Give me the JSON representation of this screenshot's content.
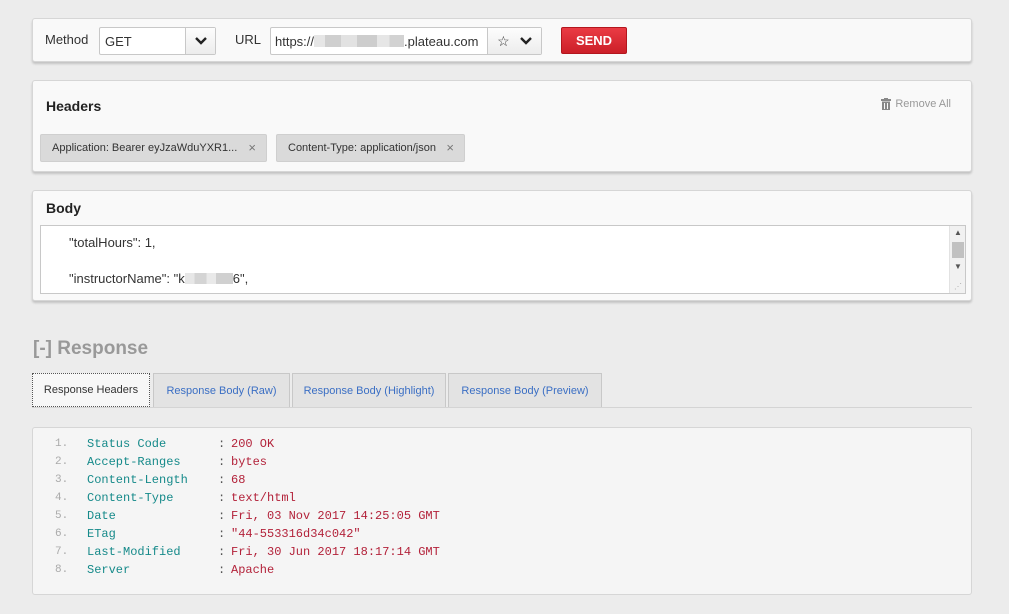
{
  "request": {
    "method_label": "Method",
    "method_value": "GET",
    "url_label": "URL",
    "url_prefix": "https://",
    "url_suffix": ".plateau.com",
    "send_label": "SEND"
  },
  "headers": {
    "title": "Headers",
    "remove_all_label": "Remove All",
    "items": [
      {
        "label": "Application: Bearer eyJzaWduYXR1..."
      },
      {
        "label": "Content-Type: application/json"
      }
    ]
  },
  "body": {
    "title": "Body",
    "line1": "\"totalHours\": 1,",
    "line2_prefix": "\"instructorName\": \"k",
    "line2_suffix": "6\","
  },
  "response": {
    "title": "[-] Response",
    "tabs": [
      {
        "label": "Response Headers"
      },
      {
        "label": "Response Body (Raw)"
      },
      {
        "label": "Response Body (Highlight)"
      },
      {
        "label": "Response Body (Preview)"
      }
    ],
    "rows": [
      {
        "num": "1.",
        "key": "Status Code",
        "value": "200 OK"
      },
      {
        "num": "2.",
        "key": "Accept-Ranges",
        "value": "bytes"
      },
      {
        "num": "3.",
        "key": "Content-Length",
        "value": "68"
      },
      {
        "num": "4.",
        "key": "Content-Type",
        "value": "text/html"
      },
      {
        "num": "5.",
        "key": "Date",
        "value": "Fri, 03 Nov 2017 14:25:05 GMT"
      },
      {
        "num": "6.",
        "key": "ETag",
        "value": "\"44-553316d34c042\""
      },
      {
        "num": "7.",
        "key": "Last-Modified",
        "value": "Fri, 30 Jun 2017 18:17:14 GMT"
      },
      {
        "num": "8.",
        "key": "Server",
        "value": "Apache"
      }
    ]
  },
  "colors": {
    "send_button": "#dd2c35",
    "response_key": "#168a8a",
    "response_value": "#b3223a",
    "tab_link": "#3b6fc4"
  }
}
